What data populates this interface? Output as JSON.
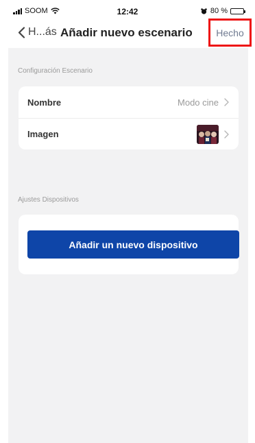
{
  "status_bar": {
    "carrier": "SOOM",
    "time": "12:42",
    "battery_percent": "80 %",
    "battery_level": 0.8
  },
  "nav": {
    "back_label": "H...ás",
    "title": "Añadir nuevo escenario",
    "done_label": "Hecho",
    "done_highlight_color": "#ee1111"
  },
  "config_section": {
    "label": "Configuración Escenario",
    "rows": [
      {
        "label": "Nombre",
        "value": "Modo cine"
      },
      {
        "label": "Imagen",
        "value": ""
      }
    ]
  },
  "devices_section": {
    "label": "Ajustes Dispositivos",
    "add_button_label": "Añadir un nuevo dispositivo",
    "accent_color": "#0e45a8"
  }
}
